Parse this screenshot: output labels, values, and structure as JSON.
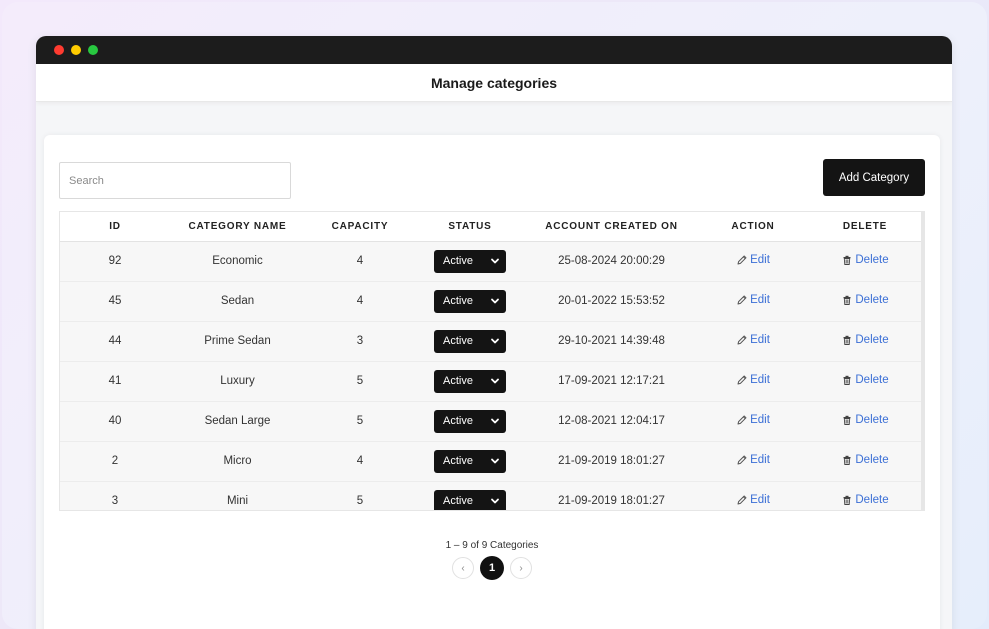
{
  "window": {
    "title": "Manage categories"
  },
  "toolbar": {
    "search_placeholder": "Search",
    "add_label": "Add Category"
  },
  "table": {
    "columns": [
      "ID",
      "CATEGORY NAME",
      "CAPACITY",
      "STATUS",
      "ACCOUNT CREATED ON",
      "ACTION",
      "DELETE"
    ],
    "rows": [
      {
        "id": "92",
        "name": "Economic",
        "capacity": "4",
        "status": "Active",
        "created": "25-08-2024 20:00:29",
        "action": "Edit",
        "delete": "Delete"
      },
      {
        "id": "45",
        "name": "Sedan",
        "capacity": "4",
        "status": "Active",
        "created": "20-01-2022 15:53:52",
        "action": "Edit",
        "delete": "Delete"
      },
      {
        "id": "44",
        "name": "Prime Sedan",
        "capacity": "3",
        "status": "Active",
        "created": "29-10-2021 14:39:48",
        "action": "Edit",
        "delete": "Delete"
      },
      {
        "id": "41",
        "name": "Luxury",
        "capacity": "5",
        "status": "Active",
        "created": "17-09-2021 12:17:21",
        "action": "Edit",
        "delete": "Delete"
      },
      {
        "id": "40",
        "name": "Sedan Large",
        "capacity": "5",
        "status": "Active",
        "created": "12-08-2021 12:04:17",
        "action": "Edit",
        "delete": "Delete"
      },
      {
        "id": "2",
        "name": "Micro",
        "capacity": "4",
        "status": "Active",
        "created": "21-09-2019 18:01:27",
        "action": "Edit",
        "delete": "Delete"
      },
      {
        "id": "3",
        "name": "Mini",
        "capacity": "5",
        "status": "Active",
        "created": "21-09-2019 18:01:27",
        "action": "Edit",
        "delete": "Delete"
      }
    ]
  },
  "pagination": {
    "summary": "1 – 9 of 9 Categories",
    "prev": "‹",
    "current": "1",
    "next": "›"
  },
  "icons": {
    "edit": "pencil-icon",
    "delete": "trash-icon",
    "status_dropdown": "chevron-down-icon"
  },
  "colors": {
    "primary": "#141414",
    "link": "#3b6fd6",
    "row_bg": "#f7f7f7"
  }
}
